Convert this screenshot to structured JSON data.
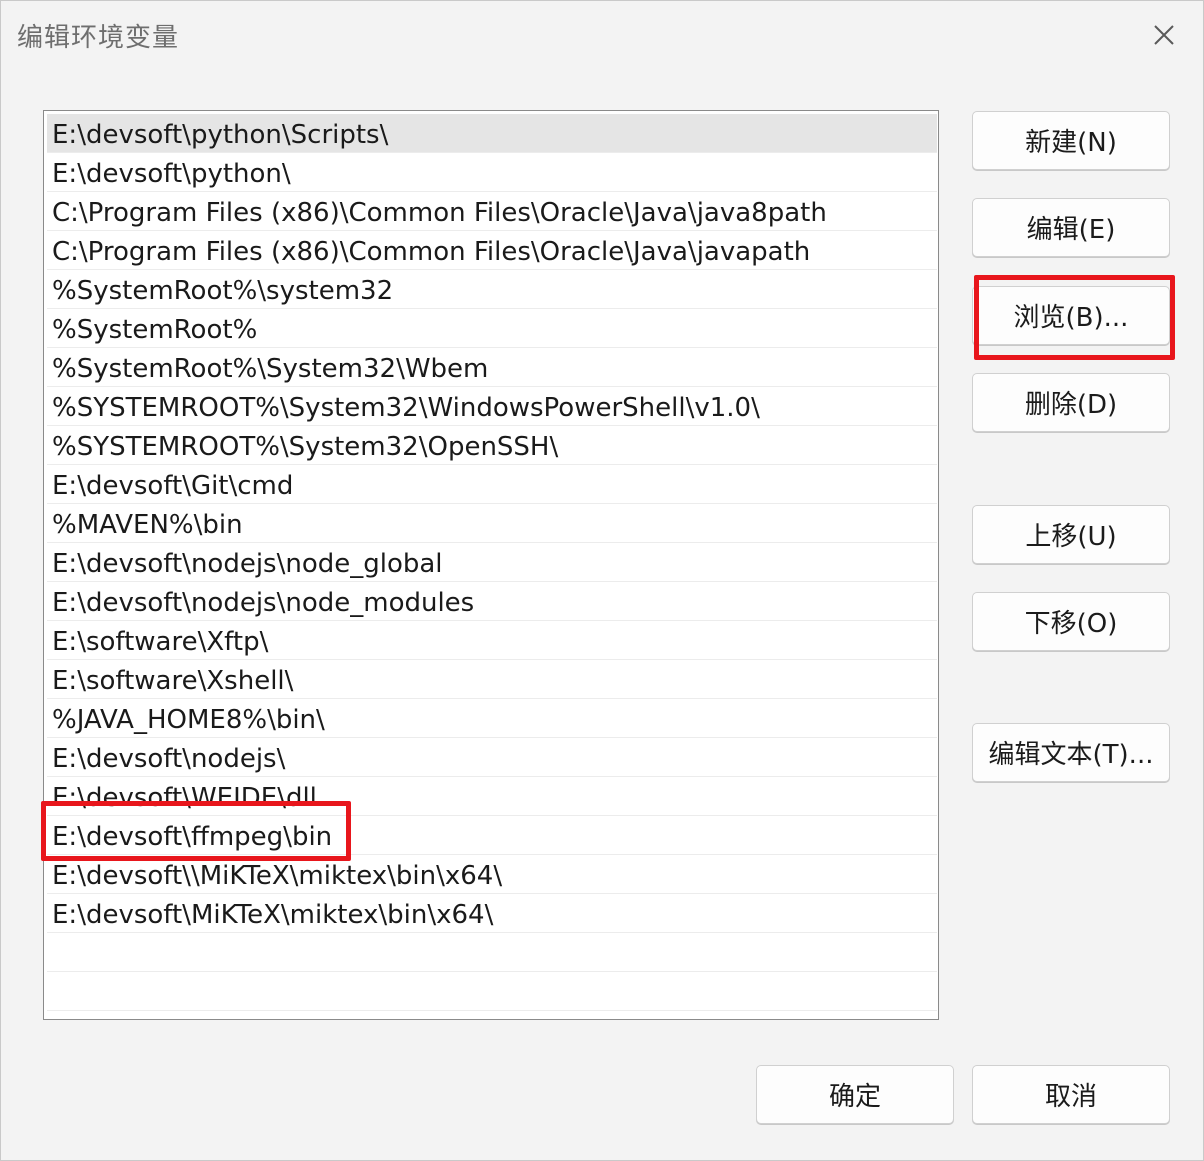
{
  "window": {
    "title": "编辑环境变量"
  },
  "path_list": {
    "items": [
      "E:\\devsoft\\python\\Scripts\\",
      "E:\\devsoft\\python\\",
      "C:\\Program Files (x86)\\Common Files\\Oracle\\Java\\java8path",
      "C:\\Program Files (x86)\\Common Files\\Oracle\\Java\\javapath",
      "%SystemRoot%\\system32",
      "%SystemRoot%",
      "%SystemRoot%\\System32\\Wbem",
      "%SYSTEMROOT%\\System32\\WindowsPowerShell\\v1.0\\",
      "%SYSTEMROOT%\\System32\\OpenSSH\\",
      "E:\\devsoft\\Git\\cmd",
      "%MAVEN%\\bin",
      "E:\\devsoft\\nodejs\\node_global",
      "E:\\devsoft\\nodejs\\node_modules",
      "E:\\software\\Xftp\\",
      "E:\\software\\Xshell\\",
      "%JAVA_HOME8%\\bin\\",
      "E:\\devsoft\\nodejs\\",
      "E:\\devsoft\\WEIDE\\dll",
      "E:\\devsoft\\ffmpeg\\bin",
      "E:\\devsoft\\\\MiKTeX\\miktex\\bin\\x64\\",
      "E:\\devsoft\\MiKTeX\\miktex\\bin\\x64\\",
      "",
      ""
    ],
    "selected_index": 0
  },
  "buttons": {
    "new": "新建(N)",
    "edit": "编辑(E)",
    "browse": "浏览(B)...",
    "delete": "删除(D)",
    "move_up": "上移(U)",
    "move_down": "下移(O)",
    "edit_text": "编辑文本(T)...",
    "ok": "确定",
    "cancel": "取消"
  },
  "annotations": {
    "highlight_color": "#e8161c"
  }
}
